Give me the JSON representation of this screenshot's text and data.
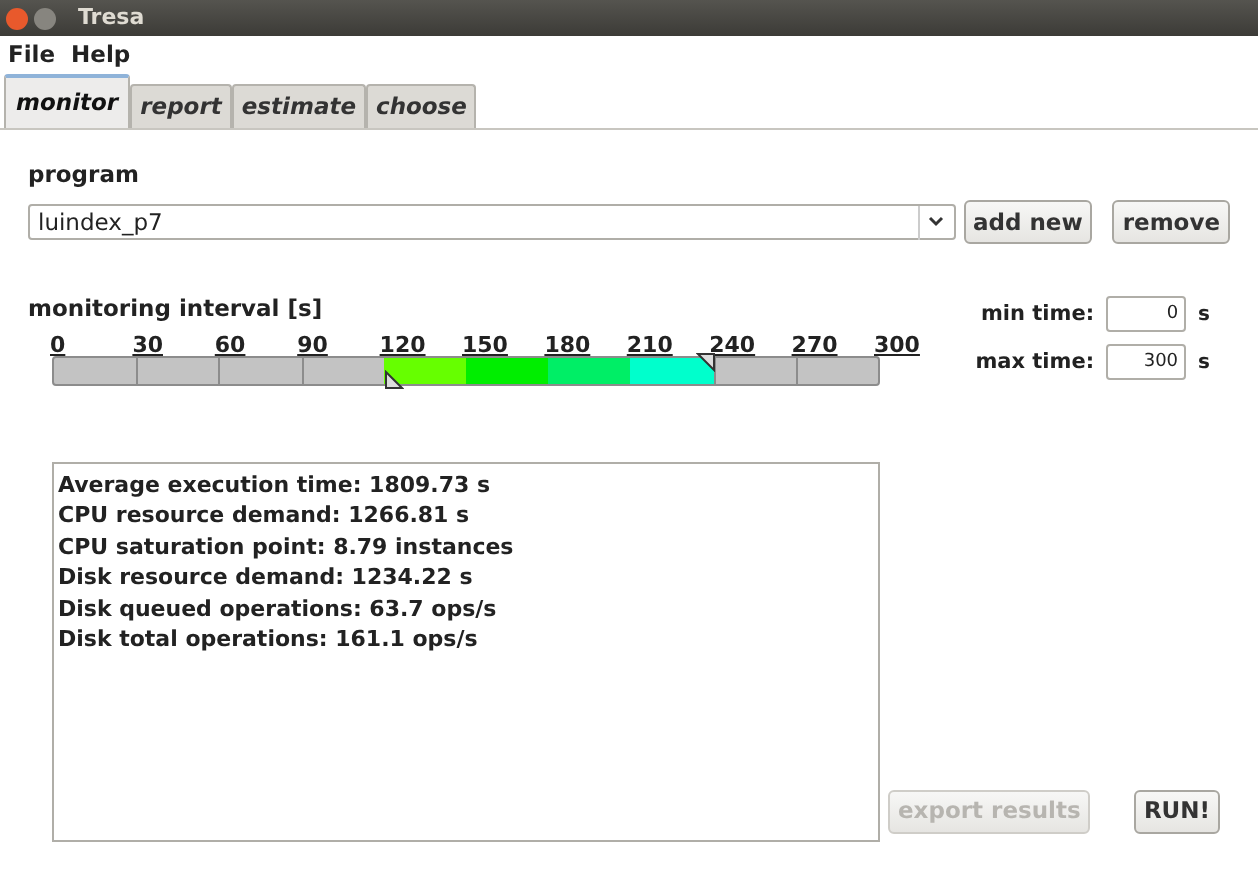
{
  "window": {
    "title": "Tresa"
  },
  "menu": [
    "File",
    "Help"
  ],
  "tabs": [
    {
      "label": "monitor",
      "selected": true
    },
    {
      "label": "report",
      "selected": false
    },
    {
      "label": "estimate",
      "selected": false
    },
    {
      "label": "choose",
      "selected": false
    }
  ],
  "program": {
    "label": "program",
    "value": "luindex_p7",
    "buttons": [
      "add new",
      "remove"
    ]
  },
  "interval": {
    "label": "monitoring interval [s]",
    "ticks": [
      "0",
      "30",
      "60",
      "90",
      "120",
      "150",
      "180",
      "210",
      "240",
      "270",
      "300"
    ],
    "start": {
      "level": 0.4
    },
    "end": {
      "level": 0.8
    },
    "segments": [
      {
        "color": "#66ff00"
      },
      {
        "color": "#00ee00"
      },
      {
        "color": "#00ee66"
      },
      {
        "color": "#00ffcc"
      }
    ]
  },
  "min_time": {
    "label": "min time:",
    "value": "0",
    "unit": "s"
  },
  "max_time": {
    "label": "max time:",
    "value": "300",
    "unit": "s"
  },
  "results": [
    "Average execution time: 1809.73 s",
    "CPU resource demand: 1266.81 s",
    "CPU saturation point: 8.79 instances",
    "Disk resource demand: 1234.22 s",
    "Disk queued operations: 63.7 ops/s",
    "Disk total operations: 161.1 ops/s"
  ],
  "export_button": {
    "label": "export results",
    "disabled": true
  },
  "run_button": {
    "label": "RUN!",
    "disabled": false
  }
}
